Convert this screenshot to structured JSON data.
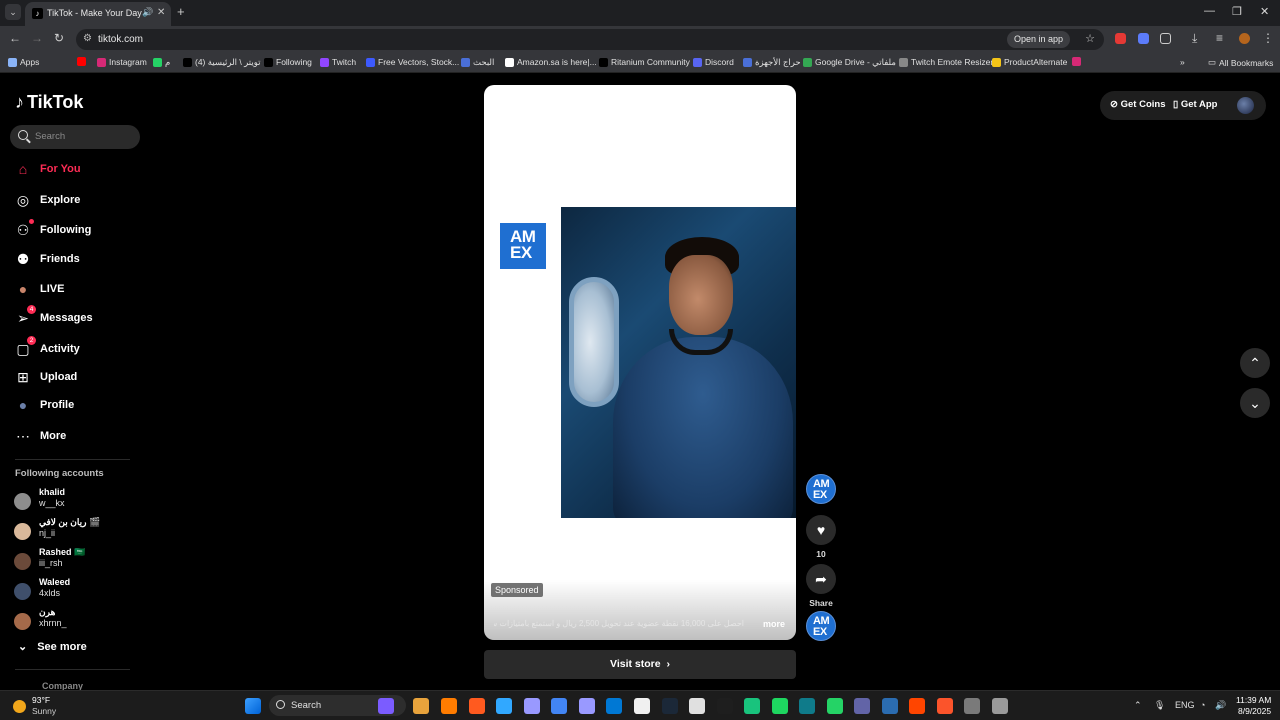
{
  "browser": {
    "tab_title": "TikTok - Make Your Day",
    "url": "tiktok.com",
    "open_in_app": "Open in app",
    "bookmarks": [
      {
        "label": "Apps",
        "color": "#8ab4f8"
      },
      {
        "label": "",
        "color": "#ff0000"
      },
      {
        "label": "Instagram",
        "color": "#d62976"
      },
      {
        "label": "م",
        "color": "#25d366"
      },
      {
        "label": "(4) تويتر \\ الرئيسية",
        "color": "#000000"
      },
      {
        "label": "Following",
        "color": "#000000"
      },
      {
        "label": "Twitch",
        "color": "#9146ff"
      },
      {
        "label": "Free Vectors, Stock...",
        "color": "#3d5afe"
      },
      {
        "label": "البحث",
        "color": "#4a6fd8"
      },
      {
        "label": "Amazon.sa is here|...",
        "color": "#ffffff"
      },
      {
        "label": "Ritanium Community",
        "color": "#000000"
      },
      {
        "label": "Discord",
        "color": "#5865f2"
      },
      {
        "label": "حراج الأجهزة",
        "color": "#4a6fd8"
      },
      {
        "label": "Google Drive - ملفاتي",
        "color": "#34a853"
      },
      {
        "label": "Twitch Emote Resizer",
        "color": "#888888"
      },
      {
        "label": "ProductAlternate",
        "color": "#f5c518"
      },
      {
        "label": "",
        "color": "#d62976"
      }
    ],
    "all_bookmarks": "All Bookmarks"
  },
  "tiktok": {
    "logo": "TikTok",
    "search_placeholder": "Search",
    "nav": [
      {
        "label": "For You",
        "icon": "home-icon",
        "active": true
      },
      {
        "label": "Explore",
        "icon": "compass-icon"
      },
      {
        "label": "Following",
        "icon": "user-follow-icon",
        "dot": true
      },
      {
        "label": "Friends",
        "icon": "friends-icon"
      },
      {
        "label": "LIVE",
        "icon": "live-avatar-icon"
      },
      {
        "label": "Messages",
        "icon": "send-icon",
        "badge": "4"
      },
      {
        "label": "Activity",
        "icon": "activity-icon",
        "badge": "2"
      },
      {
        "label": "Upload",
        "icon": "plus-square-icon"
      },
      {
        "label": "Profile",
        "icon": "profile-avatar-icon"
      },
      {
        "label": "More",
        "icon": "more-dots-icon"
      }
    ],
    "following_title": "Following accounts",
    "accounts": [
      {
        "name": "khalid",
        "handle": "w__kx",
        "color": "#8d8d8d"
      },
      {
        "name": "ريان بن لافي 🎬",
        "handle": "nj_ii",
        "color": "#d9b89a"
      },
      {
        "name": "Rashed 🇸🇦",
        "handle": "iii_rsh",
        "color": "#6b4a3a"
      },
      {
        "name": "Waleed",
        "handle": "4xlds",
        "color": "#3f4f6b"
      },
      {
        "name": "هرن",
        "handle": "xhrnn_",
        "color": "#a56a4a"
      }
    ],
    "see_more": "See more",
    "company": "Company",
    "video": {
      "brand": "AM EX",
      "sponsored": "Sponsored",
      "caption": "احصل على 16,000 نقطة عضوية عند تحويل 2,500 ريال و استمتع بامتيازات سفر رائعة ...",
      "more": "more",
      "visit_store": "Visit store"
    },
    "actions": {
      "likes": "10",
      "share": "Share"
    },
    "top_right": {
      "get_coins": "Get Coins",
      "get_app": "Get App"
    }
  },
  "taskbar": {
    "temp": "93°F",
    "condition": "Sunny",
    "search": "Search",
    "lang": "ENG",
    "time": "11:39 AM",
    "date": "8/9/2025",
    "apps": [
      "#7b5cff",
      "#e8a33c",
      "#ff7c00",
      "#ff5a1f",
      "#31a8ff",
      "#9999ff",
      "#4285f4",
      "#9999ff",
      "#0078d4",
      "#f0f0f0",
      "#1b2838",
      "#e0e0e0",
      "#1e1e1e",
      "#19c37d",
      "#1ed760",
      "#0f7b8a",
      "#25d366",
      "#6264a7",
      "#2b6cb0",
      "#ff4500",
      "#fb542b",
      "#7a7a7a",
      "#9a9a9a"
    ]
  }
}
